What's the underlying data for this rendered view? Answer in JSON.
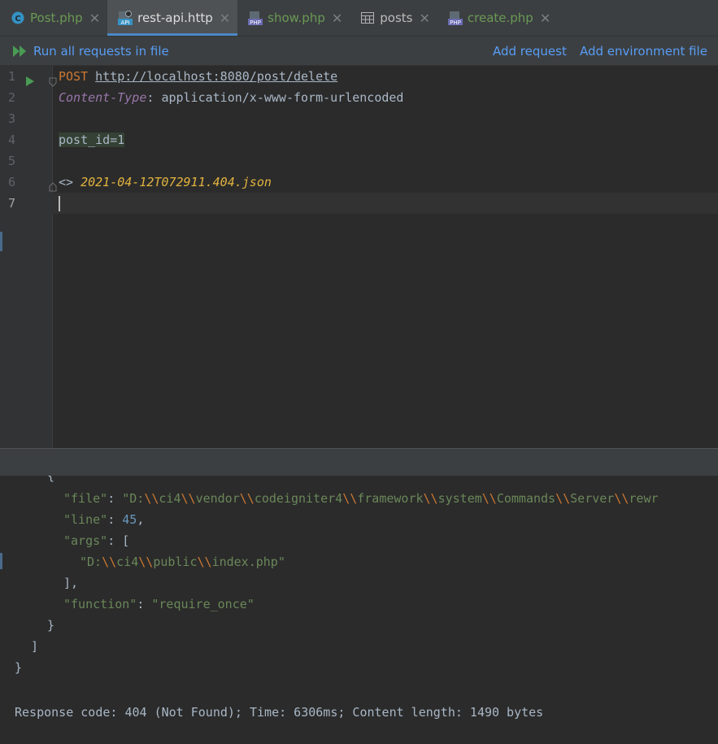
{
  "tabs": [
    {
      "label": "Post.php",
      "icon": "php-class-icon",
      "active": false
    },
    {
      "label": "rest-api.http",
      "icon": "api-file-icon",
      "active": true
    },
    {
      "label": "show.php",
      "icon": "php-file-icon",
      "active": false
    },
    {
      "label": "posts",
      "icon": "table-icon",
      "active": false
    },
    {
      "label": "create.php",
      "icon": "php-file-icon",
      "active": false
    }
  ],
  "toolbar": {
    "run_all": "Run all requests in file",
    "add_request": "Add request",
    "add_env": "Add environment file"
  },
  "editor": {
    "line_numbers": [
      "1",
      "2",
      "3",
      "4",
      "5",
      "6",
      "7"
    ],
    "method": "POST",
    "url": "http://localhost:8080/post/delete",
    "header_name": "Content-Type",
    "header_sep": ": ",
    "header_value": "application/x-www-form-urlencoded",
    "body": "post_id=1",
    "response_prefix": "<> ",
    "response_file": "2021-04-12T072911.404.json"
  },
  "console": {
    "partial_brace": "{",
    "file_key": "\"file\"",
    "file_val_a": "\"D:",
    "file_val_b": "ci4",
    "file_val_c": "vendor",
    "file_val_d": "codeigniter4",
    "file_val_e": "framework",
    "file_val_f": "system",
    "file_val_g": "Commands",
    "file_val_h": "Server",
    "file_val_i": "rewr",
    "esc": "\\\\",
    "line_key": "\"line\"",
    "line_val": "45",
    "args_key": "\"args\"",
    "args_open": "[",
    "arg0_a": "\"D:",
    "arg0_b": "ci4",
    "arg0_c": "public",
    "arg0_d": "index.php\"",
    "args_close": "],",
    "function_key": "\"function\"",
    "function_val": "\"require_once\"",
    "close_obj": "}",
    "close_arr": "]",
    "close_root": "}",
    "colon": ": ",
    "comma": ",",
    "status": "Response code: 404 (Not Found); Time: 6306ms; Content length: 1490 bytes"
  }
}
